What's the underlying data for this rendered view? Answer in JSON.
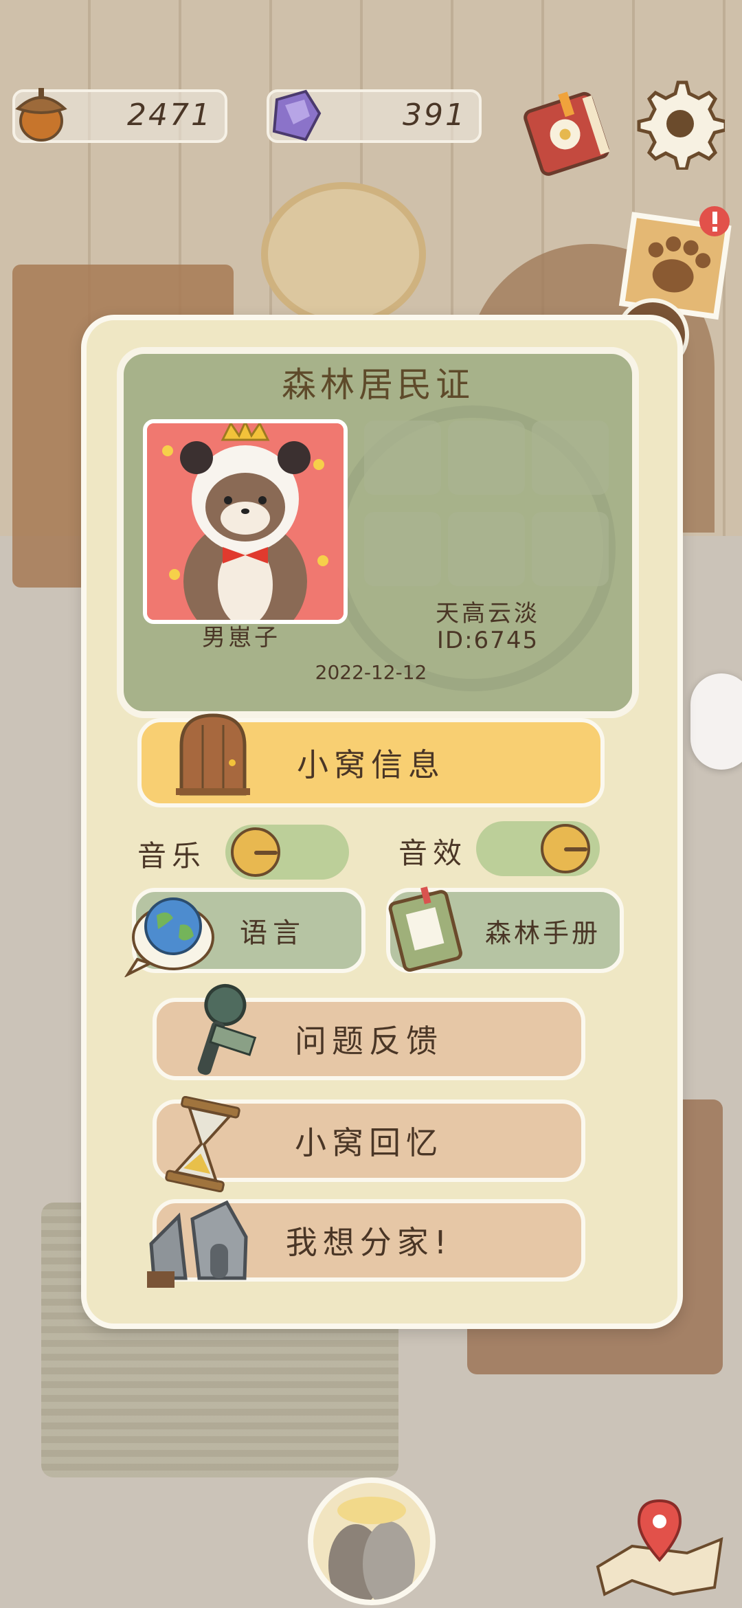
{
  "currency": {
    "acorns": "2471",
    "gems": "391"
  },
  "card": {
    "title": "森林居民证",
    "nickname": "男崽子",
    "home_name": "天高云淡",
    "resident_id": "ID:6745",
    "date": "2022-12-12"
  },
  "menu": {
    "home_info": "小窝信息",
    "music_label": "音乐",
    "sfx_label": "音效",
    "music_on": false,
    "sfx_on": true,
    "language": "语言",
    "manual": "森林手册",
    "feedback": "问题反馈",
    "memories": "小窝回忆",
    "split_home": "我想分家!"
  },
  "icons": {
    "acorn": "acorn-icon",
    "gem": "purple-gem-icon",
    "book": "journal-book-icon",
    "settings": "gear-icon",
    "paw_note": "paw-note-icon",
    "alert": "exclamation-icon",
    "back": "back-arrow-icon",
    "home_door": "door-icon",
    "globe": "globe-icon",
    "manual_book": "green-book-icon",
    "microphone": "microphone-icon",
    "hourglass": "hourglass-icon",
    "broken_house": "broken-house-icon",
    "map": "map-pin-icon"
  }
}
